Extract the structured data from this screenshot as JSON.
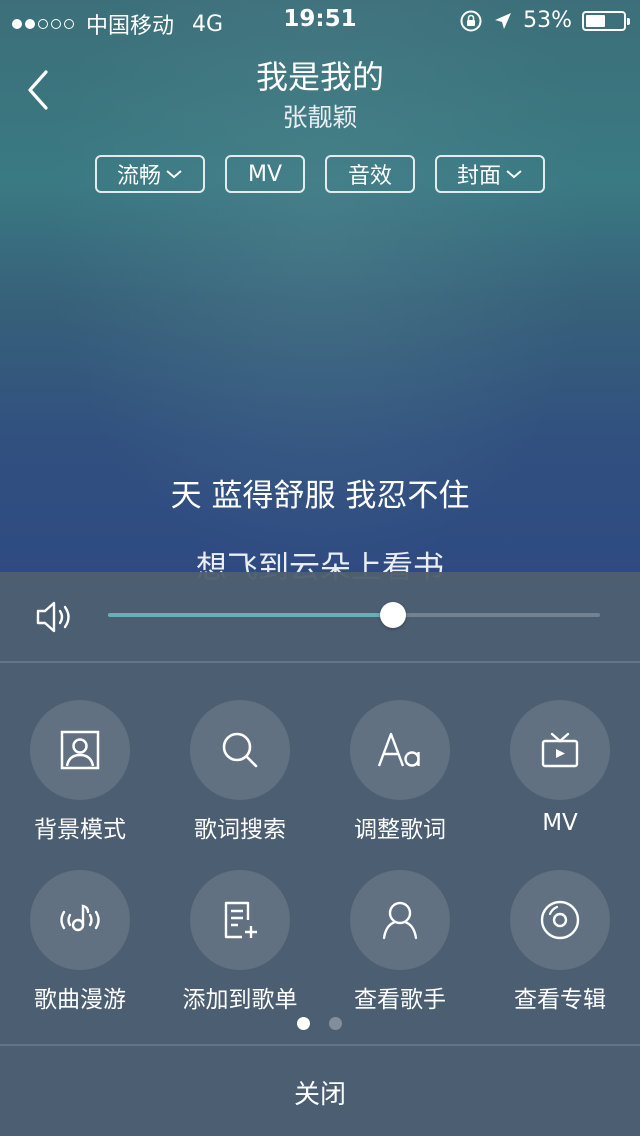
{
  "status_bar": {
    "carrier": "中国移动",
    "network": "4G",
    "time": "19:51",
    "battery_text": "53%",
    "battery_level": 0.53,
    "signal_dots_filled": 2,
    "signal_dots_total": 5
  },
  "header": {
    "title": "我是我的",
    "artist": "张靓颖",
    "tags": [
      "流畅",
      "MV",
      "音效",
      "封面"
    ]
  },
  "lyrics": {
    "current_line": "天 蓝得舒服 我忍不住",
    "next_line": "想飞到云朵上看书"
  },
  "volume": {
    "level": 0.58
  },
  "menu": {
    "row1": [
      {
        "label": "背景模式",
        "icon": "portrait-frame-icon"
      },
      {
        "label": "歌词搜索",
        "icon": "search-icon"
      },
      {
        "label": "调整歌词",
        "icon": "font-aa-icon"
      },
      {
        "label": "MV",
        "icon": "tv-icon"
      }
    ],
    "row2": [
      {
        "label": "歌曲漫游",
        "icon": "music-roam-icon"
      },
      {
        "label": "添加到歌单",
        "icon": "add-to-playlist-icon"
      },
      {
        "label": "查看歌手",
        "icon": "person-icon"
      },
      {
        "label": "查看专辑",
        "icon": "album-disc-icon"
      }
    ],
    "pages_total": 2,
    "current_page": 1
  },
  "close_label": "关闭",
  "colors": {
    "accent": "#63b1b5",
    "panel": "#4e5f70"
  }
}
